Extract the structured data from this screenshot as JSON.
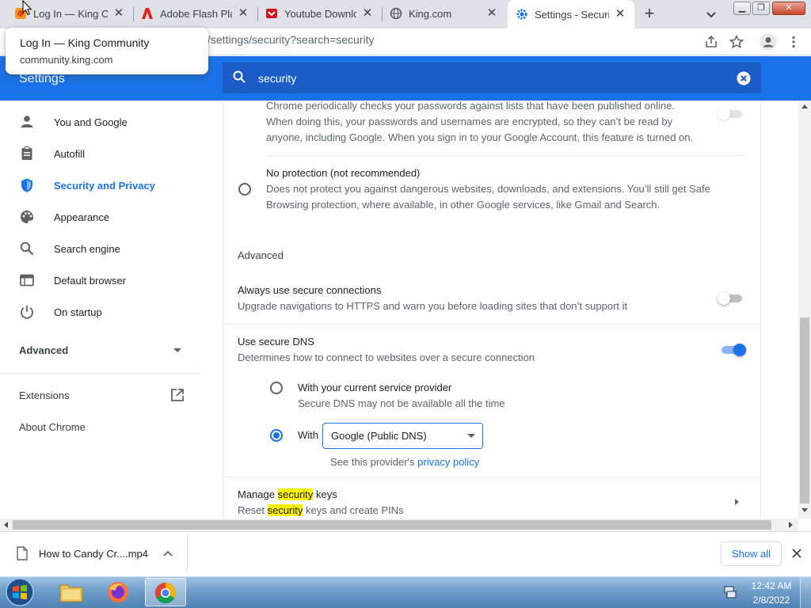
{
  "tabs": [
    {
      "title": "Log In — King Co",
      "icon": "candy-crush-favicon-icon"
    },
    {
      "title": "Adobe Flash Playe",
      "icon": "adobe-favicon-icon"
    },
    {
      "title": "Youtube Downloa",
      "icon": "youtube-downloader-favicon-icon"
    },
    {
      "title": "King.com",
      "icon": "globe-favicon-icon"
    },
    {
      "title": "Settings - Securit",
      "icon": "settings-gear-icon"
    }
  ],
  "address_bar": {
    "url": "/settings/security?search=security"
  },
  "tooltip": {
    "title": "Log In — King Community",
    "domain": "community.king.com"
  },
  "settings": {
    "title": "Settings",
    "search_value": "security"
  },
  "sidebar": {
    "items": [
      {
        "label": "You and Google",
        "icon": "person-icon",
        "active": false
      },
      {
        "label": "Autofill",
        "icon": "clipboard-icon",
        "active": false
      },
      {
        "label": "Security and Privacy",
        "icon": "shield-icon",
        "active": true
      },
      {
        "label": "Appearance",
        "icon": "palette-icon",
        "active": false
      },
      {
        "label": "Search engine",
        "icon": "search-icon",
        "active": false
      },
      {
        "label": "Default browser",
        "icon": "browser-window-icon",
        "active": false
      },
      {
        "label": "On startup",
        "icon": "power-icon",
        "active": false
      }
    ],
    "advanced": "Advanced",
    "extensions": "Extensions",
    "about": "About Chrome"
  },
  "main": {
    "password_check": {
      "line1": "Chrome periodically checks your passwords against lists that have been published online.",
      "line2": "When doing this, your passwords and usernames are encrypted, so they can’t be read by",
      "line3": "anyone, including Google. When you sign in to your Google Account, this feature is turned on."
    },
    "no_protection": {
      "title": "No protection (not recommended)",
      "line1": "Does not protect you against dangerous websites, downloads, and extensions. You’ll still get Safe",
      "line2": "Browsing protection, where available, in other Google services, like Gmail and Search."
    },
    "advanced_heading": "Advanced",
    "secure_connections": {
      "title": "Always use secure connections",
      "desc": "Upgrade navigations to HTTPS and warn you before loading sites that don’t support it",
      "enabled": false
    },
    "secure_dns": {
      "title": "Use secure DNS",
      "desc": "Determines how to connect to websites over a secure connection",
      "enabled": true,
      "option1_title": "With your current service provider",
      "option1_desc": "Secure DNS may not be available all the time",
      "option2_label": "With",
      "provider": "Google (Public DNS)",
      "provider_note": "See this provider's",
      "privacy_link": "privacy policy"
    },
    "security_keys": {
      "title_pre": "Manage",
      "title_hl": "security",
      "title_post": "keys",
      "desc_pre": "Reset",
      "desc_hl": "security",
      "desc_post": "keys and create PINs"
    }
  },
  "downloads": {
    "file": "How to Candy Cr....mp4",
    "show_all": "Show all"
  },
  "taskbar": {
    "time": "12:42 AM",
    "date": "2/8/2022"
  },
  "colors": {
    "accent": "#1a73e8",
    "highlight": "#fff200",
    "header": "#1a73e8"
  }
}
